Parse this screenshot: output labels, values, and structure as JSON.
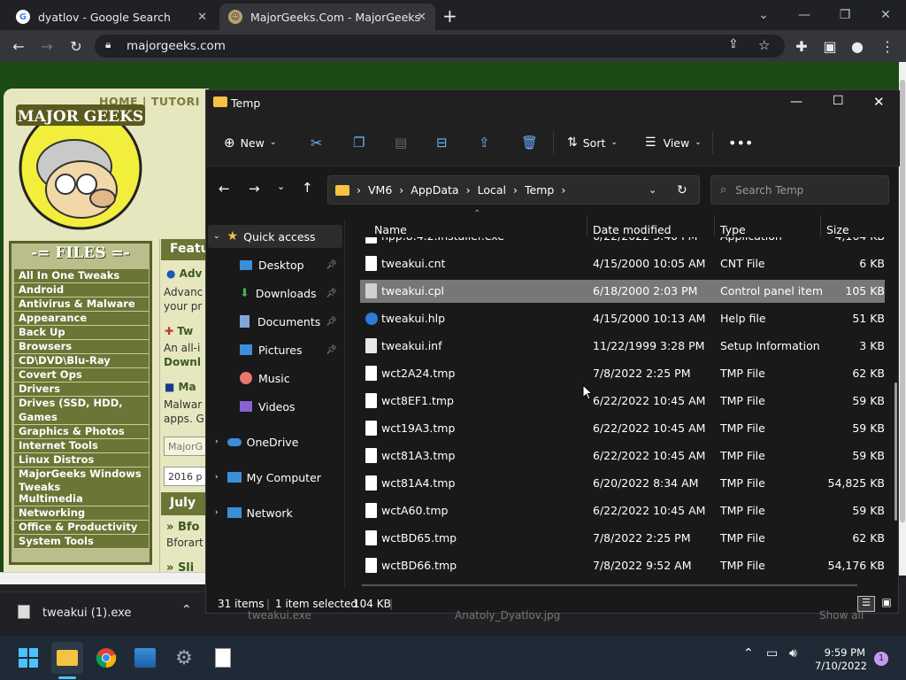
{
  "browser": {
    "tabs": [
      {
        "title": "dyatlov - Google Search",
        "icon": "google-icon"
      },
      {
        "title": "MajorGeeks.Com - MajorGeeks",
        "icon": "majorgeeks-icon"
      }
    ],
    "url": "majorgeeks.com"
  },
  "site": {
    "nav": "HOME | TUTORI",
    "files_heading": "-= FILES =-",
    "categories": [
      "All In One Tweaks",
      "Android",
      "Antivirus & Malware",
      "Appearance",
      "Back Up",
      "Browsers",
      "CD\\DVD\\Blu-Ray",
      "Covert Ops",
      "Drivers",
      "Drives (SSD, HDD, USB)",
      "Games",
      "Graphics & Photos",
      "Internet Tools",
      "Linux Distros",
      "MajorGeeks Windows Tweaks",
      "Multimedia",
      "Networking",
      "Office & Productivity",
      "System Tools"
    ],
    "mid_texts": [
      "Featu",
      "Adv",
      "Advanc",
      "your pr",
      "Tw",
      "An all-i",
      "Downl",
      "Ma",
      "Malwar",
      "apps. G",
      "MajorG",
      "2016 p",
      "July",
      "Bfo",
      "Bforart",
      "Sli"
    ]
  },
  "explorer": {
    "title": "Temp",
    "commands": {
      "new": "New",
      "sort": "Sort",
      "view": "View"
    },
    "breadcrumb": [
      "VM6",
      "AppData",
      "Local",
      "Temp"
    ],
    "search_placeholder": "Search Temp",
    "nav": {
      "quick_access": "Quick access",
      "desktop": "Desktop",
      "downloads": "Downloads",
      "documents": "Documents",
      "pictures": "Pictures",
      "music": "Music",
      "videos": "Videos",
      "onedrive": "OneDrive",
      "my_computer": "My Computer",
      "network": "Network"
    },
    "columns": {
      "name": "Name",
      "date": "Date modified",
      "type": "Type",
      "size": "Size"
    },
    "files": [
      {
        "name": "npp.8.4.2.Installer.exe",
        "date": "6/22/2022 3:40 PM",
        "type": "Application",
        "size": "4,164 KB"
      },
      {
        "name": "tweakui.cnt",
        "date": "4/15/2000 10:05 AM",
        "type": "CNT File",
        "size": "6 KB"
      },
      {
        "name": "tweakui.cpl",
        "date": "6/18/2000 2:03 PM",
        "type": "Control panel item",
        "size": "105 KB"
      },
      {
        "name": "tweakui.hlp",
        "date": "4/15/2000 10:13 AM",
        "type": "Help file",
        "size": "51 KB"
      },
      {
        "name": "tweakui.inf",
        "date": "11/22/1999 3:28 PM",
        "type": "Setup Information",
        "size": "3 KB"
      },
      {
        "name": "wct2A24.tmp",
        "date": "7/8/2022 2:25 PM",
        "type": "TMP File",
        "size": "62 KB"
      },
      {
        "name": "wct8EF1.tmp",
        "date": "6/22/2022 10:45 AM",
        "type": "TMP File",
        "size": "59 KB"
      },
      {
        "name": "wct19A3.tmp",
        "date": "6/22/2022 10:45 AM",
        "type": "TMP File",
        "size": "59 KB"
      },
      {
        "name": "wct81A3.tmp",
        "date": "6/22/2022 10:45 AM",
        "type": "TMP File",
        "size": "59 KB"
      },
      {
        "name": "wct81A4.tmp",
        "date": "6/20/2022 8:34 AM",
        "type": "TMP File",
        "size": "54,825 KB"
      },
      {
        "name": "wctA60.tmp",
        "date": "6/22/2022 10:45 AM",
        "type": "TMP File",
        "size": "59 KB"
      },
      {
        "name": "wctBD65.tmp",
        "date": "7/8/2022 2:25 PM",
        "type": "TMP File",
        "size": "62 KB"
      },
      {
        "name": "wctBD66.tmp",
        "date": "7/8/2022 9:52 AM",
        "type": "TMP File",
        "size": "54,176 KB"
      }
    ],
    "status": {
      "items": "31 items",
      "selected": "1 item selected",
      "size": "104 KB"
    }
  },
  "downloads_shelf": {
    "file": "tweakui (1).exe",
    "behind": [
      "tweakui.exe",
      "Anatoly_Dyatlov.jpg",
      "Show all"
    ]
  },
  "taskbar": {
    "time": "9:59 PM",
    "date": "7/10/2022",
    "notifications": "1"
  }
}
